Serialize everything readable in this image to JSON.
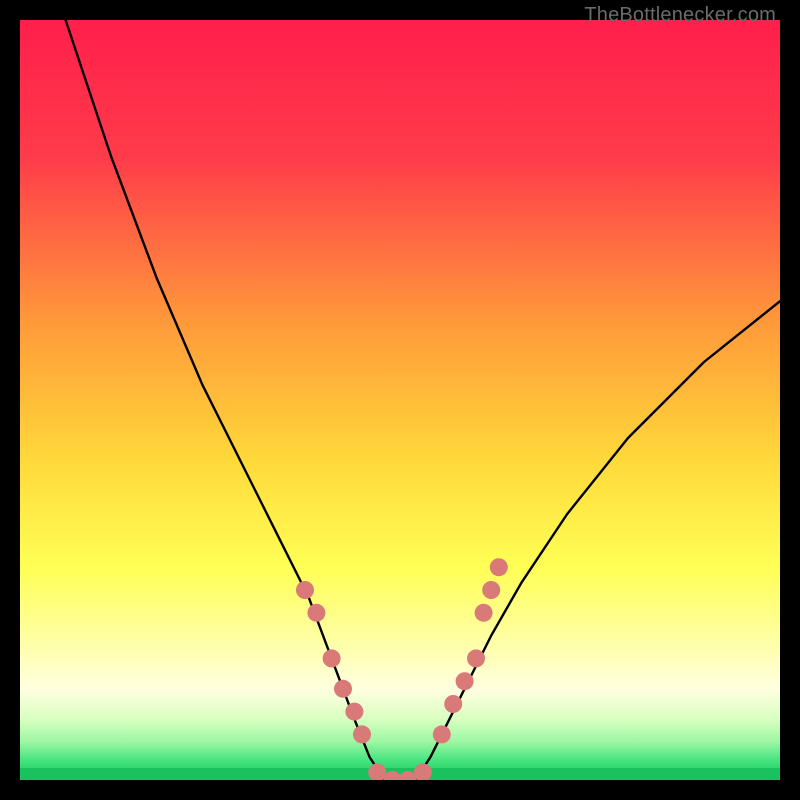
{
  "watermark": {
    "text": "TheBottlenecker.com"
  },
  "chart_data": {
    "type": "line",
    "title": "",
    "xlabel": "",
    "ylabel": "",
    "xlim": [
      0,
      100
    ],
    "ylim": [
      0,
      100
    ],
    "curve_comment": "V-shaped bottleneck curve; minimum ≈0 near x≈47–53, rising steeply left of that and moderately to the right.",
    "x": [
      0,
      6,
      12,
      18,
      24,
      30,
      34,
      38,
      41,
      44,
      46,
      48,
      50,
      52,
      54,
      56,
      59,
      62,
      66,
      72,
      80,
      90,
      100
    ],
    "y": [
      120,
      100,
      82,
      66,
      52,
      40,
      32,
      24,
      16,
      8,
      3,
      0,
      0,
      0,
      3,
      7,
      13,
      19,
      26,
      35,
      45,
      55,
      63
    ],
    "markers_comment": "Salmon-pink dots clustered along the lower flanks and floor of the V.",
    "markers": [
      {
        "x": 37.5,
        "y": 25
      },
      {
        "x": 39.0,
        "y": 22
      },
      {
        "x": 41.0,
        "y": 16
      },
      {
        "x": 42.5,
        "y": 12
      },
      {
        "x": 44.0,
        "y": 9
      },
      {
        "x": 45.0,
        "y": 6
      },
      {
        "x": 47.0,
        "y": 1
      },
      {
        "x": 49.0,
        "y": 0
      },
      {
        "x": 51.0,
        "y": 0
      },
      {
        "x": 53.0,
        "y": 1
      },
      {
        "x": 55.5,
        "y": 6
      },
      {
        "x": 57.0,
        "y": 10
      },
      {
        "x": 58.5,
        "y": 13
      },
      {
        "x": 60.0,
        "y": 16
      },
      {
        "x": 61.0,
        "y": 22
      },
      {
        "x": 62.0,
        "y": 25
      },
      {
        "x": 63.0,
        "y": 28
      }
    ],
    "gradient_stops": [
      {
        "offset": 0.0,
        "color": "#ff1f4b"
      },
      {
        "offset": 0.18,
        "color": "#ff3b4a"
      },
      {
        "offset": 0.4,
        "color": "#ff9a3a"
      },
      {
        "offset": 0.58,
        "color": "#ffd93a"
      },
      {
        "offset": 0.72,
        "color": "#ffff55"
      },
      {
        "offset": 0.82,
        "color": "#ffffa8"
      },
      {
        "offset": 0.88,
        "color": "#ffffe0"
      },
      {
        "offset": 0.92,
        "color": "#d8ffc0"
      },
      {
        "offset": 0.95,
        "color": "#9cf7a2"
      },
      {
        "offset": 0.975,
        "color": "#43e37e"
      },
      {
        "offset": 1.0,
        "color": "#18c35e"
      }
    ],
    "marker_color": "#d97a78",
    "curve_color": "#000000",
    "green_band_y": 0
  }
}
